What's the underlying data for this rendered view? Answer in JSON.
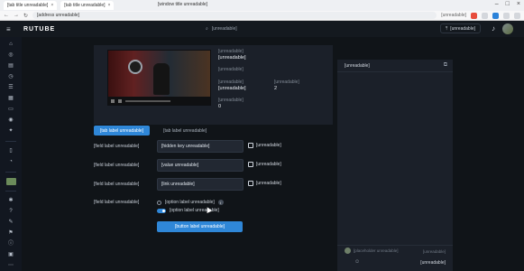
{
  "browser": {
    "tab_label": "[tab title unreadable]",
    "tab_label_2": "[tab title unreadable]",
    "window_title": "[window title unreadable]",
    "url": "[address unreadable]",
    "extension_text": "[unreadable]"
  },
  "app": {
    "brand": "RUTUBE",
    "search_text": "[unreadable]",
    "upload_label": "[unreadable]"
  },
  "stream": {
    "title_label": "[unreadable]",
    "title_value": "[unreadable]",
    "status_label": "[unreadable]",
    "category_label": "[unreadable]",
    "category_value": "[unreadable]",
    "viewers_label": "[unreadable]",
    "viewers_value": "2",
    "extra_label": "[unreadable]",
    "extra_value": "0"
  },
  "tabs": [
    "[tab label unreadable]",
    "[tab label unreadable]"
  ],
  "form": {
    "rows": [
      {
        "label": "[field label unreadable]",
        "value": "[hidden key unreadable]",
        "copy": "[unreadable]"
      },
      {
        "label": "[field label unreadable]",
        "value": "[value unreadable]",
        "copy": "[unreadable]"
      },
      {
        "label": "[field label unreadable]",
        "value": "[link unreadable]",
        "copy": "[unreadable]"
      }
    ],
    "options_label": "[field label unreadable]",
    "option1": "[option label unreadable]",
    "option2": "[option label unreadable]",
    "submit": "[button label unreadable]"
  },
  "chat": {
    "title": "[unreadable]",
    "placeholder": "[placeholder unreadable]",
    "count": "[unreadable]",
    "send": "[unreadable]"
  },
  "colors": {
    "accent": "#2f87d8",
    "background": "#101418",
    "panel": "#1b2029"
  }
}
